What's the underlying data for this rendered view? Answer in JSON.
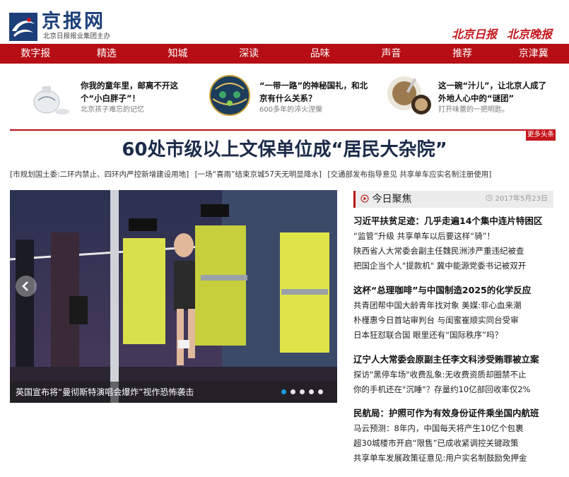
{
  "header": {
    "logo_name": "京报网",
    "logo_slogan": "北京日报报业集团主办",
    "partners": [
      "北京日报",
      "北京晚报"
    ]
  },
  "nav": [
    "数字报",
    "精选",
    "知城",
    "深读",
    "品味",
    "声音",
    "推荐",
    "京津冀"
  ],
  "features": [
    {
      "title": "你我的童年里，邮离不开这个“小白胖子”！",
      "sub": "北京孩子难忘的记忆",
      "icon": "porcelain-pot-icon"
    },
    {
      "title": "“一带一路”的神秘国礼，和北京有什么关系？",
      "sub": "600多年的淬火涅槃",
      "icon": "cloisonne-ball-icon"
    },
    {
      "title": "这一碗“汁儿”，让北京人成了外地人心中的“谜团”",
      "sub": "打开味蕾的一把明匙。",
      "icon": "douzhi-bowl-icon"
    }
  ],
  "more_badge": "更多头条",
  "headline": "60处市级以上文保单位成“居民大杂院”",
  "subnews": [
    "[市规划国土委:二环内禁止、四环内严控新增建设用地]",
    "[一场“喜雨”结束京城57天无明显降水]",
    "[交通部发布指导意见 共享单车应实名制注册使用]"
  ],
  "slide": {
    "caption": "英国宣布将“曼彻斯特演唱会爆炸”视作恐怖袭击",
    "dots": 5,
    "active_dot": 0
  },
  "focus": {
    "title": "今日聚焦",
    "date": "2017年5月23日"
  },
  "news_blocks": [
    {
      "lead": "习近平扶贫足迹：几乎走遍14个集中连片特困区",
      "lines": [
        "“监管”升级 共享单车以后要这样“骑”！",
        "陕西省人大常委会副主任魏民洲涉严重违纪被查",
        "把国企当个人\"提款机\" 冀中能源党委书记被双开"
      ]
    },
    {
      "lead": "这杯“总理咖啡”与中国制造2025的化学反应",
      "lines": [
        "共青团帮中国大龄青年找对象 美媒:非心血来潮",
        "朴槿惠今日首站审判台 与闺蜜崔顺实同台受审",
        "日本狂怼联合国 眼里还有“国际秩序”吗？"
      ]
    },
    {
      "lead": "辽宁人大常委会原副主任李文科涉受贿罪被立案",
      "lines": [
        "探访\"黑停车场\"收费乱象:无收费资质却圈禁不止",
        "你的手机还在\"沉睡\"？存量约10亿部回收率仅2%"
      ]
    },
    {
      "lead": "民航局：护照可作为有效身份证件乘坐国内航班",
      "lines": [
        "马云预测：8年内，中国每天将产生10亿个包裹",
        "超30城楼市开启“限售”已成收紧调控关键政策",
        "共享单车发展政策征意见:用户实名制鼓励免押金"
      ]
    }
  ],
  "colors": {
    "brand_red": "#b60e14",
    "logo_blue": "#1c3f79",
    "headline_navy": "#1c2b4a",
    "dot_active": "#1e9be6"
  }
}
